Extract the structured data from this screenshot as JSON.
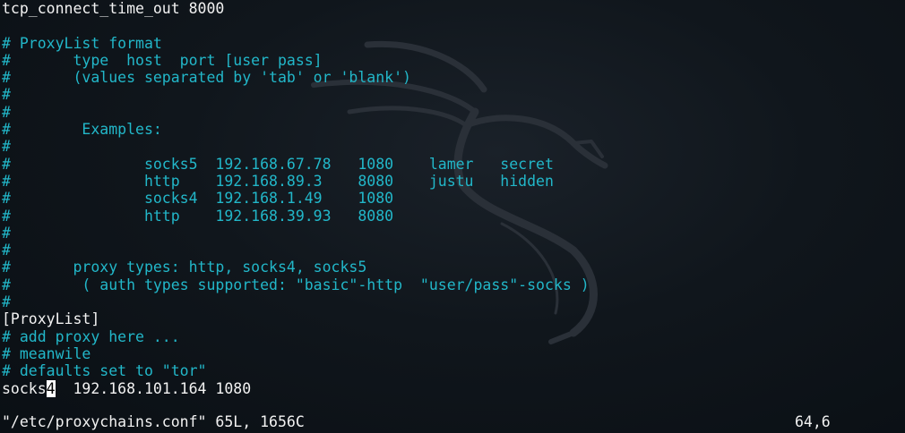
{
  "editor": {
    "lines": [
      {
        "text": "tcp_connect_time_out 8000",
        "kind": "normal"
      },
      {
        "text": "",
        "kind": "normal"
      },
      {
        "text": "# ProxyList format",
        "kind": "comment"
      },
      {
        "text": "#       type  host  port [user pass]",
        "kind": "comment"
      },
      {
        "text": "#       (values separated by 'tab' or 'blank')",
        "kind": "comment"
      },
      {
        "text": "#",
        "kind": "comment"
      },
      {
        "text": "#",
        "kind": "comment"
      },
      {
        "text": "#        Examples:",
        "kind": "comment"
      },
      {
        "text": "#",
        "kind": "comment"
      },
      {
        "text": "#               socks5  192.168.67.78   1080    lamer   secret",
        "kind": "comment"
      },
      {
        "text": "#               http    192.168.89.3    8080    justu   hidden",
        "kind": "comment"
      },
      {
        "text": "#               socks4  192.168.1.49    1080",
        "kind": "comment"
      },
      {
        "text": "#               http    192.168.39.93   8080",
        "kind": "comment"
      },
      {
        "text": "#",
        "kind": "comment"
      },
      {
        "text": "#",
        "kind": "comment"
      },
      {
        "text": "#       proxy types: http, socks4, socks5",
        "kind": "comment"
      },
      {
        "text": "#        ( auth types supported: \"basic\"-http  \"user/pass\"-socks )",
        "kind": "comment"
      },
      {
        "text": "#",
        "kind": "comment"
      },
      {
        "text": "[ProxyList]",
        "kind": "normal"
      },
      {
        "text": "# add proxy here ...",
        "kind": "comment"
      },
      {
        "text": "# meanwile",
        "kind": "comment"
      },
      {
        "text": "# defaults set to \"tor\"",
        "kind": "comment"
      }
    ],
    "active_line": {
      "before_cursor": "socks",
      "cursor_char": "4",
      "after_cursor": "  192.168.101.164 1080"
    }
  },
  "status_bar": {
    "file_info": "\"/etc/proxychains.conf\" 65L, 1656C",
    "cursor_position": "64,6"
  },
  "colors": {
    "comment": "#22b7c9",
    "text": "#f2f2f2",
    "background": "#0b1116",
    "cursor": "#ffffff"
  },
  "watermark": {
    "icon": "kali-dragon-icon"
  }
}
